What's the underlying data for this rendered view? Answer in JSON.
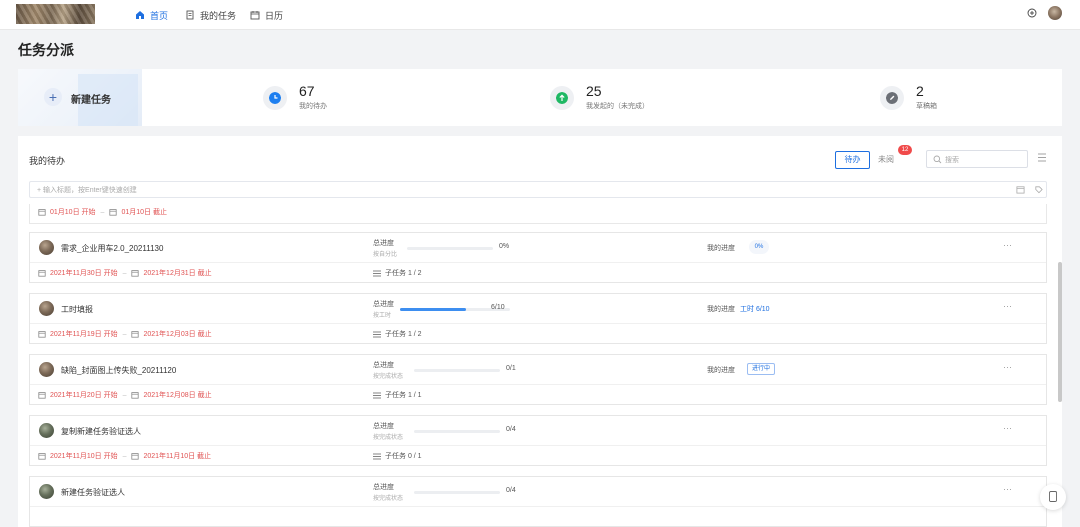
{
  "nav": {
    "items": [
      {
        "label": "首页",
        "icon": "home-icon",
        "active": true
      },
      {
        "label": "我的任务",
        "icon": "document-icon",
        "active": false
      },
      {
        "label": "日历",
        "icon": "calendar-icon",
        "active": false
      }
    ]
  },
  "page_title": "任务分派",
  "stats": {
    "new_task_label": "新建任务",
    "items": [
      {
        "value": "67",
        "label": "我的待办",
        "color": "#1e7ff0",
        "icon": "clock-icon"
      },
      {
        "value": "25",
        "label": "我发起的（未完成）",
        "color": "#1fb864",
        "icon": "upload-icon"
      },
      {
        "value": "2",
        "label": "草稿箱",
        "color": "#6b6f76",
        "icon": "pencil-icon"
      }
    ]
  },
  "panel": {
    "title": "我的待办",
    "filter_pending": "待办",
    "filter_unread": "未阅",
    "unread_count": "12",
    "search_placeholder": "搜索",
    "quick_input_placeholder": "+ 输入标题，按Enter键快速创建"
  },
  "partial_row": {
    "start": "01月10日 开始",
    "end": "01月10日 截止"
  },
  "tasks": [
    {
      "name": "需求_企业用车2.0_20211130",
      "progress_label": "总进度",
      "progress_sub": "按自分比",
      "progress_value": "0%",
      "progress_fraction": 0,
      "my_label": "我的进度",
      "my_value": "0%",
      "start": "2021年11月30日 开始",
      "end": "2021年12月31日 截止",
      "subtask": "子任务 1 / 2"
    },
    {
      "name": "工时填报",
      "progress_label": "总进度",
      "progress_sub": "按工时",
      "progress_value": "6/10",
      "progress_fraction": 0.6,
      "my_label": "我的进度",
      "my_value": "工时 6/10",
      "start": "2021年11月19日 开始",
      "end": "2021年12月03日 截止",
      "subtask": "子任务 1 / 2"
    },
    {
      "name": "缺陷_封面图上传失败_20211120",
      "progress_label": "总进度",
      "progress_sub": "按完成状态",
      "progress_value": "0/1",
      "progress_fraction": 0,
      "my_label": "我的进度",
      "my_value": "进行中",
      "start": "2021年11月20日 开始",
      "end": "2021年12月08日 截止",
      "subtask": "子任务 1 / 1"
    },
    {
      "name": "复制新建任务验证选人",
      "progress_label": "总进度",
      "progress_sub": "按完成状态",
      "progress_value": "0/4",
      "progress_fraction": 0,
      "start": "2021年11月10日 开始",
      "end": "2021年11月10日 截止",
      "subtask": "子任务 0 / 1"
    },
    {
      "name": "新建任务验证选人",
      "progress_label": "总进度",
      "progress_sub": "按完成状态",
      "progress_value": "0/4",
      "progress_fraction": 0
    }
  ]
}
